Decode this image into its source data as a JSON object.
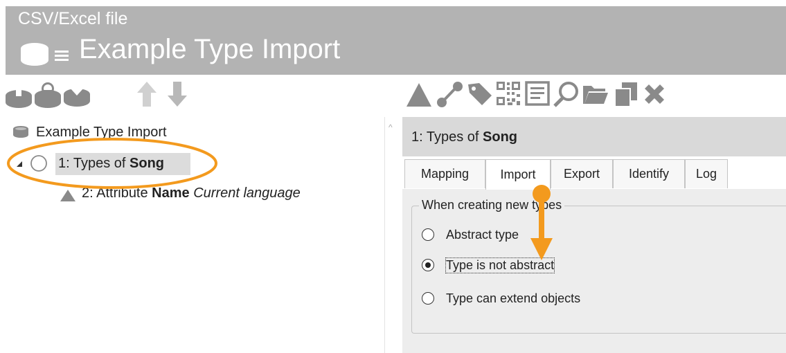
{
  "window": {
    "subtitle": "CSV/Excel file",
    "title": "Example Type Import"
  },
  "toolbar_left": {
    "icons": [
      "upload-icon",
      "refresh-icon",
      "download-icon",
      "move-up-icon",
      "move-down-icon"
    ]
  },
  "toolbar_right": {
    "icons": [
      "triangle-icon",
      "relation-icon",
      "tag-icon",
      "qr-code-icon",
      "form-icon",
      "search-icon",
      "folder-icon",
      "copy-icon",
      "delete-icon"
    ]
  },
  "tree": {
    "root": "Example Type Import",
    "item1": {
      "prefix": "1: Types of ",
      "bold": "Song"
    },
    "item2": {
      "prefix": "2: Attribute ",
      "bold": "Name",
      "italic": "Current language"
    }
  },
  "panel": {
    "title_prefix": "1: Types of ",
    "title_bold": "Song",
    "tabs": [
      "Mapping",
      "Import",
      "Export",
      "Identify",
      "Log"
    ],
    "active_tab": "Import",
    "group_label": "When creating new types",
    "options": [
      "Abstract type",
      "Type is not abstract",
      "Type can extend objects"
    ],
    "selected_option": "Type is not abstract"
  },
  "annotation_color": "#f39a1e",
  "header_color": "#b3b3b3"
}
